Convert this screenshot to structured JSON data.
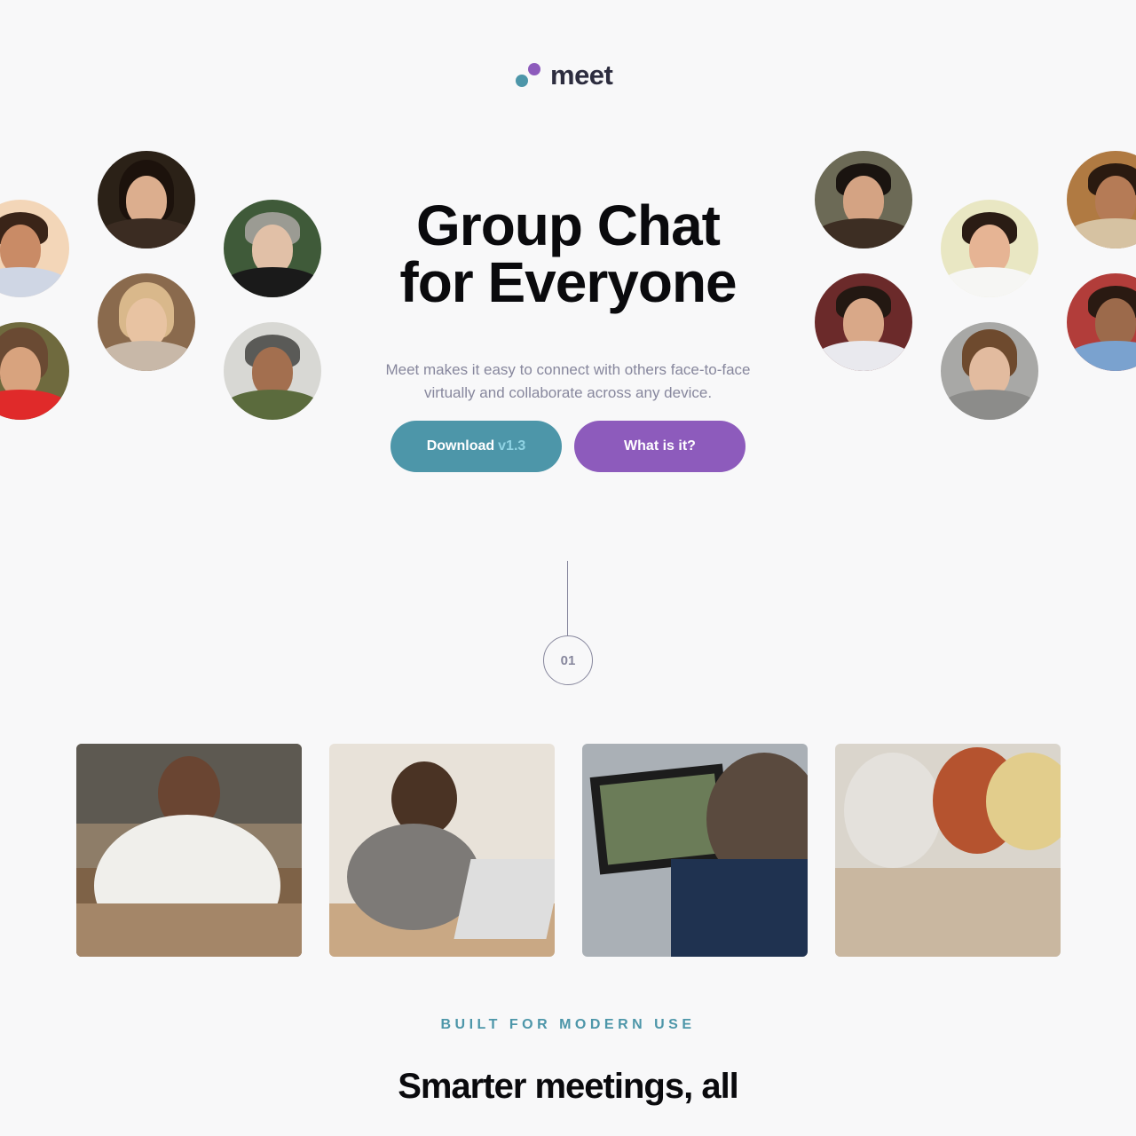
{
  "brand": {
    "name": "meet",
    "colors": {
      "teal": "#4d96a9",
      "purple": "#8d5bbc",
      "dark": "#2d2d3f",
      "muted": "#87879d",
      "background": "#f8f8f9"
    }
  },
  "hero": {
    "title_line1": "Group Chat",
    "title_line2": "for Everyone",
    "description": "Meet makes it easy to connect with others face-to-face virtually and collaborate across any device.",
    "download_label": "Download",
    "download_version": "v1.3",
    "what_label": "What is it?"
  },
  "step": {
    "number": "01"
  },
  "photos": [
    {
      "name": "man-smiling-at-phone-photo"
    },
    {
      "name": "woman-laughing-at-laptop-photo"
    },
    {
      "name": "man-on-video-call-photo"
    },
    {
      "name": "women-looking-at-phone-photo"
    }
  ],
  "section": {
    "eyebrow": "BUILT FOR MODERN USE",
    "title": "Smarter meetings, all"
  }
}
